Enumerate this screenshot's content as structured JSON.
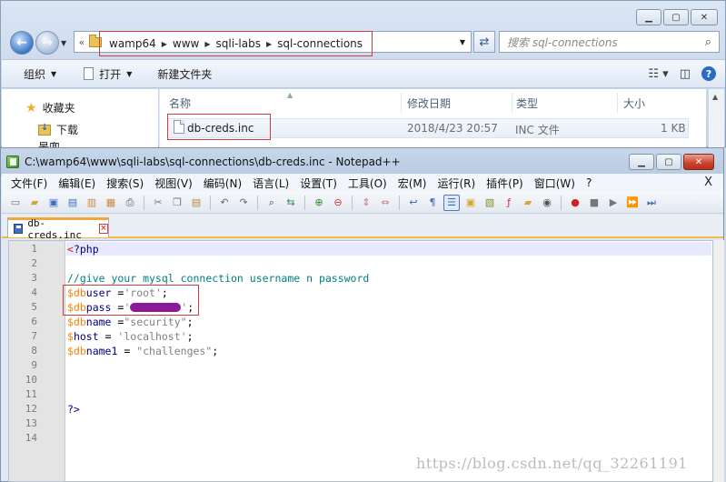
{
  "explorer": {
    "breadcrumb": [
      "wamp64",
      "www",
      "sqli-labs",
      "sql-connections"
    ],
    "addr_prefix": "«",
    "search_placeholder": "搜索 sql-connections",
    "commands": {
      "organize": "组织",
      "open": "打开",
      "new_folder": "新建文件夹"
    },
    "sidebar": {
      "favorites": "收藏夹",
      "downloads": "下载",
      "desktop": "桌面"
    },
    "columns": {
      "name": "名称",
      "modified": "修改日期",
      "type": "类型",
      "size": "大小"
    },
    "files": [
      {
        "name": "db-creds.inc",
        "modified": "2018/4/23 20:57",
        "type": "INC 文件",
        "size": "1 KB"
      }
    ]
  },
  "notepad": {
    "title": "C:\\wamp64\\www\\sqli-labs\\sql-connections\\db-creds.inc - Notepad++",
    "menu": [
      "文件(F)",
      "编辑(E)",
      "搜索(S)",
      "视图(V)",
      "编码(N)",
      "语言(L)",
      "设置(T)",
      "工具(O)",
      "宏(M)",
      "运行(R)",
      "插件(P)",
      "窗口(W)",
      "?"
    ],
    "menu_close": "X",
    "tab_label": "db-creds.inc",
    "line_numbers": [
      "1",
      "2",
      "3",
      "4",
      "5",
      "6",
      "7",
      "8",
      "9",
      "10",
      "11",
      "12",
      "13",
      "14"
    ],
    "code": {
      "l1_lt": "<",
      "l1_rest": "?php",
      "l3": "//give your mysql connection username n password",
      "l4_dollar": "$db",
      "l4_var": "user",
      "l4_op": " =",
      "l4_str": "'root'",
      "l4_end": ";",
      "l5_dollar": "$db",
      "l5_var": "pass",
      "l5_op": " =",
      "l5_q1": "'",
      "l5_q2": "'",
      "l5_end": ";",
      "l6_dollar": "$db",
      "l6_var": "name",
      "l6_op": " =",
      "l6_str": "\"security\"",
      "l6_end": ";",
      "l7_dollar": "$",
      "l7_var": "host",
      "l7_op": " = ",
      "l7_str": "'localhost'",
      "l7_end": ";",
      "l8_dollar": "$db",
      "l8_var": "name1",
      "l8_op": " = ",
      "l8_str": "\"challenges\"",
      "l8_end": ";",
      "l12": "?>"
    }
  },
  "watermark": "https://blog.csdn.net/qq_32261191",
  "colors": {
    "accent_red": "#d23b3b",
    "tab_orange": "#f4a53a",
    "redaction": "#8b1a9a"
  }
}
